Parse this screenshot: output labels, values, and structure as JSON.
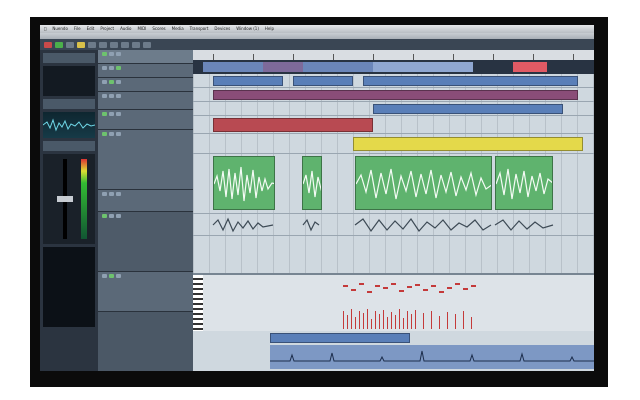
{
  "window": {
    "title": "",
    "menu": [
      "Nuendo",
      "File",
      "Edit",
      "Project",
      "Audio",
      "MIDI",
      "Scores",
      "Media",
      "Transport",
      "Devices",
      "Window (1)",
      "Help"
    ]
  },
  "tracks": [
    {
      "name": "",
      "type": "folder"
    },
    {
      "name": "",
      "type": "midi"
    },
    {
      "name": "",
      "type": "midi"
    },
    {
      "name": "",
      "type": "midi"
    },
    {
      "name": "",
      "type": "midi"
    },
    {
      "name": "",
      "type": "audio"
    },
    {
      "name": "",
      "type": "audio"
    },
    {
      "name": "",
      "type": "instrument"
    },
    {
      "name": "",
      "type": "automation"
    }
  ],
  "colors": {
    "screen_bg": "#1e2630",
    "audio_event": "#5fb36e",
    "midi_red": "#b84a52",
    "midi_purple": "#8a4d78",
    "midi_blue": "#5a7fb8",
    "midi_yellow": "#e4d94a",
    "overview_red": "#e05a64"
  },
  "icons": {
    "apple": "apple-icon",
    "play": "play-icon",
    "stop": "stop-icon",
    "record": "record-icon"
  }
}
